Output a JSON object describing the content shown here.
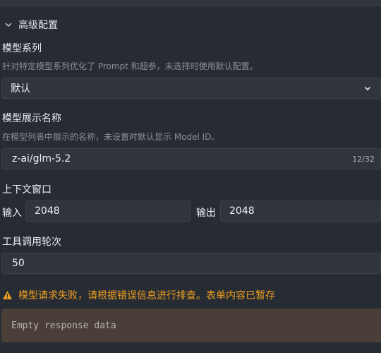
{
  "advanced": {
    "section_title": "高级配置",
    "model_family": {
      "label": "模型系列",
      "hint": "针对特定模型系列优化了 Prompt 和超参，未选择时使用默认配置。",
      "selected": "默认"
    },
    "display_name": {
      "label": "模型展示名称",
      "hint": "在模型列表中展示的名称，未设置时默认显示 Model ID。",
      "value": "z-ai/glm-5.2",
      "counter": "12/32"
    },
    "context_window": {
      "label": "上下文窗口",
      "input_label": "输入",
      "input_value": "2048",
      "output_label": "输出",
      "output_value": "2048"
    },
    "tool_rounds": {
      "label": "工具调用轮次",
      "value": "50"
    }
  },
  "error": {
    "message": "模型请求失败，请根据错误信息进行排查。表单内容已暂存",
    "detail": "Empty response data"
  },
  "colors": {
    "background": "#272b33",
    "warning": "#f0a020",
    "error_box": "#4a3f38"
  }
}
